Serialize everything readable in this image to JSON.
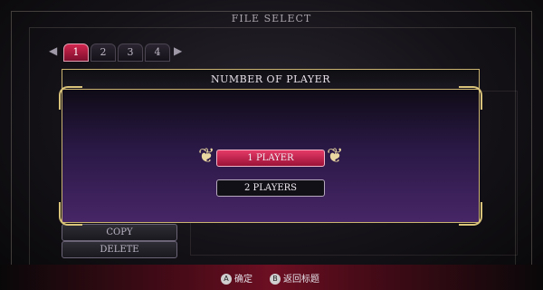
{
  "screen": {
    "title": "FILE SELECT"
  },
  "tabs": {
    "left_arrow": "◀",
    "right_arrow": "▶",
    "items": [
      {
        "label": "1"
      },
      {
        "label": "2"
      },
      {
        "label": "3"
      },
      {
        "label": "4"
      }
    ],
    "active": "1"
  },
  "sidebar": {
    "copy_label": "COPY",
    "delete_label": "DELETE"
  },
  "modal": {
    "title": "NUMBER OF PLAYER",
    "options": [
      {
        "label": "1 PLAYER",
        "selected": true
      },
      {
        "label": "2 PLAYERS",
        "selected": false
      }
    ]
  },
  "footer": {
    "a_button": "A",
    "a_label": "确定",
    "b_button": "B",
    "b_label": "返回标题"
  },
  "colors": {
    "accent": "#d2264f",
    "gold": "#cbb472"
  }
}
